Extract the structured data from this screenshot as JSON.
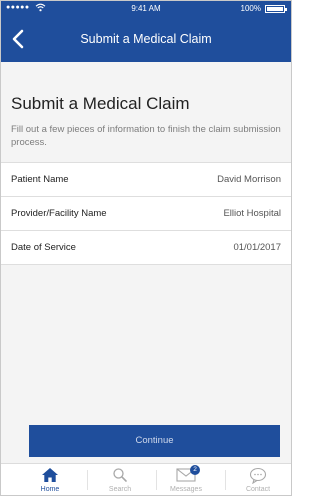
{
  "status_bar": {
    "signal": "●●●●●",
    "time": "9:41 AM",
    "battery": "100%"
  },
  "nav": {
    "title": "Submit a Medical Claim"
  },
  "header": {
    "heading": "Submit a Medical Claim",
    "subtext": "Fill out a few pieces of information to finish the claim submission process."
  },
  "fields": [
    {
      "label": "Patient Name",
      "value": "David Morrison"
    },
    {
      "label": "Provider/Facility Name",
      "value": "Elliot Hospital"
    },
    {
      "label": "Date of Service",
      "value": "01/01/2017"
    }
  ],
  "continue_label": "Continue",
  "tabs": [
    {
      "label": "Home",
      "icon": "home-icon",
      "active": true
    },
    {
      "label": "Search",
      "icon": "search-icon"
    },
    {
      "label": "Messages",
      "icon": "envelope-icon",
      "badge": "2"
    },
    {
      "label": "Contact",
      "icon": "chat-bubble-icon"
    }
  ],
  "colors": {
    "primary": "#1f4e9c",
    "background": "#f4f4f4",
    "muted_text": "#7d7d7d"
  }
}
